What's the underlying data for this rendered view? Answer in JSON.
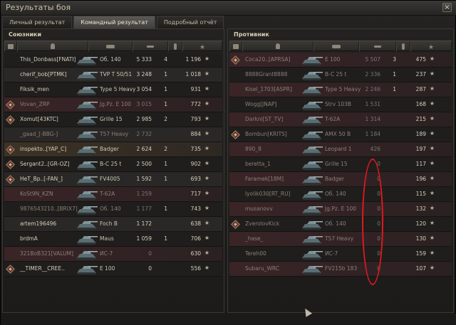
{
  "window": {
    "title": "Результаты боя",
    "close_label": "×"
  },
  "tabs": [
    {
      "label": "Личный результат"
    },
    {
      "label": "Командный результат"
    },
    {
      "label": "Подробный отчёт"
    }
  ],
  "colors": {
    "highlight_row": "#3d3225",
    "annotation": "#e1181e"
  },
  "allies": {
    "title": "Союзники",
    "rows": [
      {
        "player": "This_Donbass[FNATI]",
        "tank": "Об. 140",
        "damage": "5 333",
        "kills": "4",
        "xp": "1 196",
        "dead": false,
        "platoon": false,
        "style": "dark"
      },
      {
        "player": "cherif_bob[PTMK]",
        "tank": "TVP T 50/51",
        "damage": "3 248",
        "kills": "1",
        "xp": "1 018",
        "dead": false,
        "platoon": false,
        "style": "alt"
      },
      {
        "player": "Fiksik_men",
        "tank": "Type 5 Heavy",
        "damage": "3 054",
        "kills": "1",
        "xp": "931",
        "dead": false,
        "platoon": false,
        "style": "dark"
      },
      {
        "player": "Vovan_ZRP",
        "tank": "Jg.Pz. E 100",
        "damage": "3 015",
        "kills": "1",
        "xp": "772",
        "dead": true,
        "platoon": true,
        "style": "red"
      },
      {
        "player": "Xomut[43KTC]",
        "tank": "Grille 15",
        "damage": "2 985",
        "kills": "2",
        "xp": "793",
        "dead": false,
        "platoon": true,
        "style": "dark"
      },
      {
        "player": "_gaad_[-BBG-]",
        "tank": "T57 Heavy",
        "damage": "2 732",
        "kills": "",
        "xp": "884",
        "dead": true,
        "platoon": false,
        "style": "alt"
      },
      {
        "player": "inspekto..[YAP_C]",
        "tank": "Badger",
        "damage": "2 624",
        "kills": "2",
        "xp": "735",
        "dead": false,
        "platoon": true,
        "style": "hl"
      },
      {
        "player": "Sergant2..[GR-OZ]",
        "tank": "B-C 25 t",
        "damage": "2 500",
        "kills": "1",
        "xp": "902",
        "dead": false,
        "platoon": true,
        "style": "dark"
      },
      {
        "player": "HeT_Bp..[-FAN_]",
        "tank": "FV4005",
        "damage": "1 592",
        "kills": "1",
        "xp": "693",
        "dead": false,
        "platoon": true,
        "style": "alt"
      },
      {
        "player": "KoSt9N_KZN",
        "tank": "T-62A",
        "damage": "1 259",
        "kills": "",
        "xp": "717",
        "dead": true,
        "platoon": false,
        "style": "red"
      },
      {
        "player": "9876543210..[BRIX7]",
        "tank": "Об. 140",
        "damage": "1 177",
        "kills": "1",
        "xp": "743",
        "dead": true,
        "platoon": false,
        "style": "dark"
      },
      {
        "player": "artem196496",
        "tank": "Foch B",
        "damage": "1 172",
        "kills": "",
        "xp": "638",
        "dead": false,
        "platoon": false,
        "style": "alt"
      },
      {
        "player": "brdmA",
        "tank": "Maus",
        "damage": "1 059",
        "kills": "1",
        "xp": "706",
        "dead": false,
        "platoon": false,
        "style": "dark"
      },
      {
        "player": "321BoB321[VALUM]",
        "tank": "ИС-7",
        "damage": "0",
        "kills": "",
        "xp": "630",
        "dead": true,
        "platoon": false,
        "style": "red"
      },
      {
        "player": "__TIMER__CREE..",
        "tank": "E 100",
        "damage": "0",
        "kills": "",
        "xp": "556",
        "dead": false,
        "platoon": true,
        "style": "dark"
      }
    ]
  },
  "enemies": {
    "title": "Противник",
    "rows": [
      {
        "player": "Coca20..[APRSA]",
        "tank": "E 100",
        "damage": "5 507",
        "kills": "3",
        "xp": "475",
        "dead": true,
        "platoon": true,
        "style": "red"
      },
      {
        "player": "8888Grant8888",
        "tank": "B-C 25 t",
        "damage": "2 336",
        "kills": "1",
        "xp": "237",
        "dead": true,
        "platoon": false,
        "style": "dark"
      },
      {
        "player": "Kisel_1703[ASPR]",
        "tank": "Type 5 Heavy",
        "damage": "2 246",
        "kills": "1",
        "xp": "287",
        "dead": true,
        "platoon": false,
        "style": "red"
      },
      {
        "player": "Wogg[JNAP]",
        "tank": "Strv 103B",
        "damage": "1 531",
        "kills": "",
        "xp": "168",
        "dead": true,
        "platoon": false,
        "style": "dark"
      },
      {
        "player": "Darkni[ST_TV]",
        "tank": "T-62A",
        "damage": "1 314",
        "kills": "",
        "xp": "215",
        "dead": true,
        "platoon": false,
        "style": "red"
      },
      {
        "player": "Bombun[KRITS]",
        "tank": "AMX 50 B",
        "damage": "1 184",
        "kills": "",
        "xp": "189",
        "dead": true,
        "platoon": true,
        "style": "dark"
      },
      {
        "player": "890_8",
        "tank": "Leopard 1",
        "damage": "426",
        "kills": "",
        "xp": "197",
        "dead": true,
        "platoon": false,
        "style": "red"
      },
      {
        "player": "beretta_1",
        "tank": "Grille 15",
        "damage": "0",
        "kills": "",
        "xp": "117",
        "dead": true,
        "platoon": false,
        "style": "dark"
      },
      {
        "player": "Faramek[18M]",
        "tank": "Badger",
        "damage": "0",
        "kills": "",
        "xp": "196",
        "dead": true,
        "platoon": false,
        "style": "red"
      },
      {
        "player": "lyolik030[RT_RU]",
        "tank": "Об. 140",
        "damage": "0",
        "kills": "",
        "xp": "115",
        "dead": true,
        "platoon": false,
        "style": "dark"
      },
      {
        "player": "musanovv",
        "tank": "Jg.Pz. E 100",
        "damage": "0",
        "kills": "",
        "xp": "132",
        "dead": true,
        "platoon": false,
        "style": "red"
      },
      {
        "player": "ZverolovKick",
        "tank": "Об. 140",
        "damage": "0",
        "kills": "",
        "xp": "120",
        "dead": true,
        "platoon": true,
        "style": "dark"
      },
      {
        "player": "_hase_",
        "tank": "T57 Heavy",
        "damage": "0",
        "kills": "",
        "xp": "130",
        "dead": true,
        "platoon": false,
        "style": "red"
      },
      {
        "player": "Tereh00",
        "tank": "ИС-7",
        "damage": "0",
        "kills": "",
        "xp": "159",
        "dead": true,
        "platoon": false,
        "style": "dark"
      },
      {
        "player": "Subaru_WRC",
        "tank": "FV215b 183",
        "damage": "0",
        "kills": "",
        "xp": "107",
        "dead": true,
        "platoon": false,
        "style": "red"
      }
    ]
  }
}
